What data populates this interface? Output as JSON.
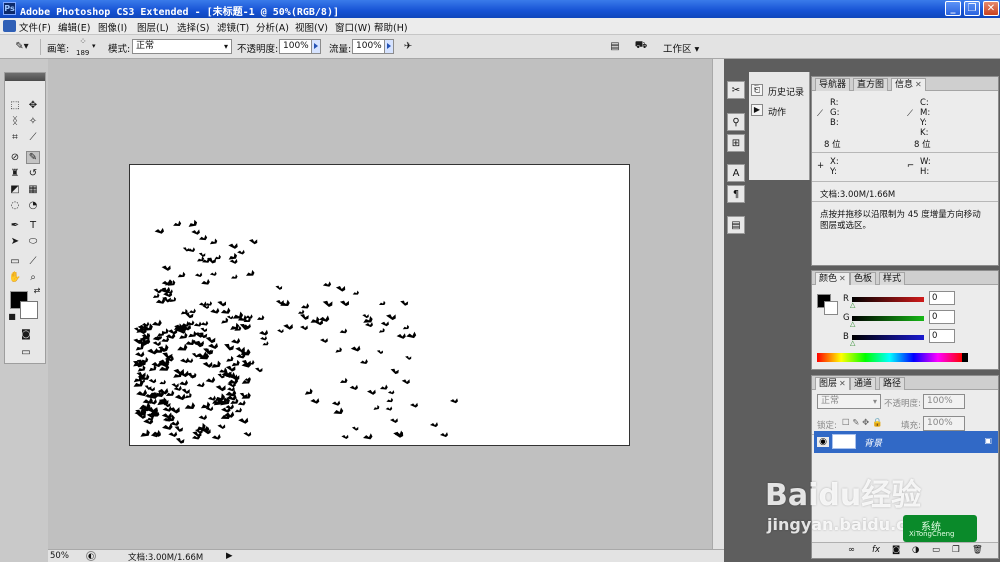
{
  "window": {
    "title": "Adobe Photoshop CS3 Extended - [未标题-1 @ 50%(RGB/8)]",
    "logo_text": "Ps",
    "buttons": [
      "_",
      "❐",
      "✕"
    ]
  },
  "menu": [
    "文件(F)",
    "编辑(E)",
    "图像(I)",
    "图层(L)",
    "选择(S)",
    "滤镜(T)",
    "分析(A)",
    "视图(V)",
    "窗口(W)",
    "帮助(H)"
  ],
  "options": {
    "brush_label": "画笔:",
    "brush_size": "189",
    "mode_label": "模式:",
    "mode_value": "正常",
    "opacity_label": "不透明度:",
    "opacity_value": "100%",
    "flow_label": "流量:",
    "flow_value": "100%",
    "workspace_label": "工作区 ▾"
  },
  "status": {
    "zoom": "50%",
    "doc_info": "文档:3.00M/1.66M"
  },
  "history_panel": {
    "items": [
      {
        "label": "历史记录",
        "icon": "history-icon"
      },
      {
        "label": "动作",
        "icon": "actions-icon"
      }
    ]
  },
  "info_panel": {
    "tabs": [
      "导航器",
      "直方图",
      "信息"
    ],
    "r": "R:",
    "g": "G:",
    "b": "B:",
    "c": "C:",
    "m": "M:",
    "y": "Y:",
    "k": "K:",
    "bit_left": "8 位",
    "bit_right": "8 位",
    "x": "X:",
    "yy": "Y:",
    "w": "W:",
    "h": "H:",
    "doc": "文档:3.00M/1.66M",
    "hint_line1": "点按并拖移以沿限制为 45 度增量方向移动",
    "hint_line2": "图层或选区。"
  },
  "color_panel": {
    "tabs": [
      "颜色",
      "色板",
      "样式"
    ],
    "r_label": "R",
    "g_label": "G",
    "b_label": "B",
    "r_value": "0",
    "g_value": "0",
    "b_value": "0",
    "colors": {
      "r": "#d01a1a",
      "g": "#16b816",
      "b": "#1a1ad0"
    }
  },
  "layers_panel": {
    "tabs": [
      "图层",
      "通道",
      "路径"
    ],
    "blend": "正常",
    "opacity_label": "不透明度:",
    "opacity_value": "100%",
    "lock_label": "锁定:",
    "fill_label": "填充:",
    "fill_value": "100%",
    "layer_name": "背景",
    "footer_icons": [
      "link-icon",
      "fx-icon",
      "mask-icon",
      "adjustment-icon",
      "group-icon",
      "new-layer-icon",
      "trash-icon"
    ]
  },
  "watermark": {
    "brand": "Baidu经验",
    "url": "jingyan.baidu.com"
  },
  "badge": {
    "line1": "系统",
    "line2": "XiTongCheng"
  }
}
